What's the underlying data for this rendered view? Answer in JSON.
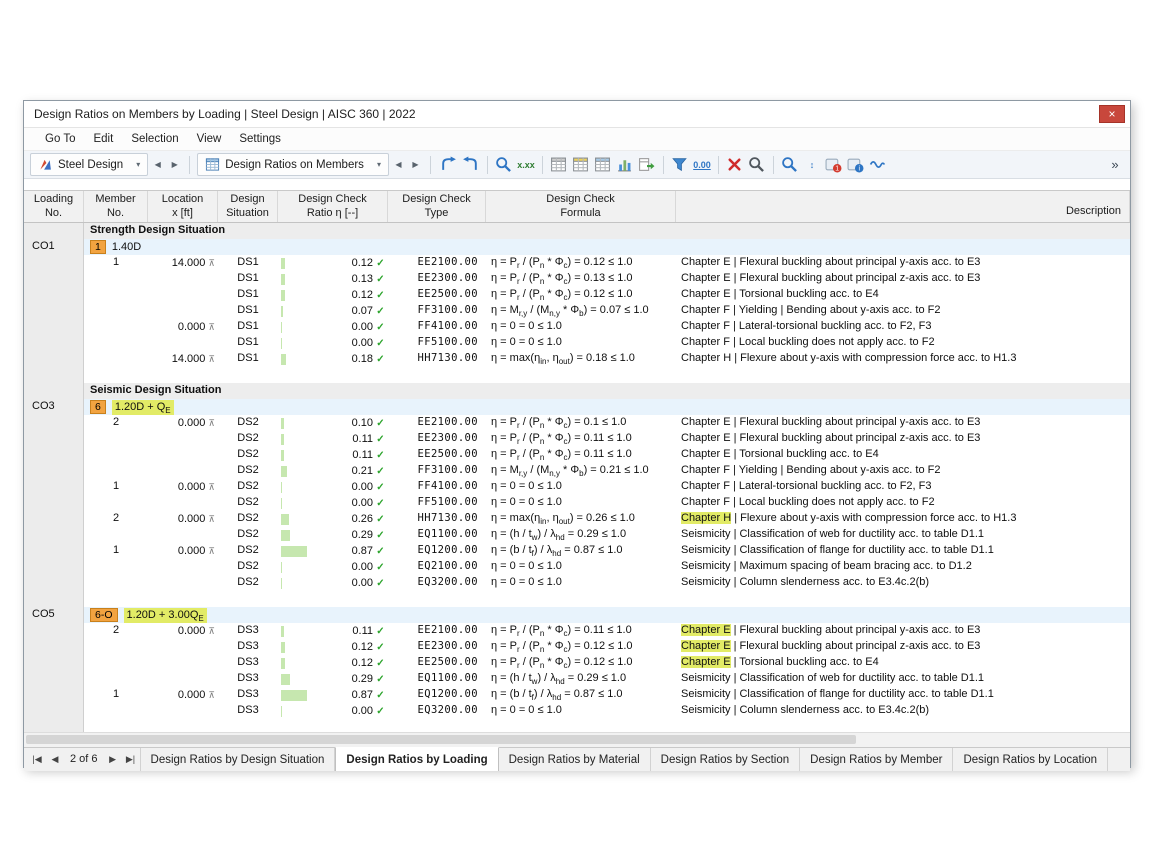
{
  "window": {
    "title": "Design Ratios on Members by Loading | Steel Design | AISC 360 | 2022"
  },
  "glyphs": {
    "close": "×",
    "chevron_down": "▾",
    "prev": "◀",
    "next": "▶",
    "first": "|◀",
    "last": "▶|",
    "check": "✓",
    "loc_extreme": "⊼",
    "overflow": "»"
  },
  "menu": {
    "items": [
      "Go To",
      "Edit",
      "Selection",
      "View",
      "Settings"
    ]
  },
  "toolbar": {
    "module_selector": "Steel Design",
    "table_selector": "Design Ratios on Members",
    "icon_groups": [
      [
        {
          "name": "show-in-graphic",
          "shape": "curve1"
        },
        {
          "name": "result-diagrams",
          "shape": "curve2"
        }
      ],
      [
        {
          "name": "search-result-values",
          "shape": "magnifier-blue"
        },
        {
          "name": "edit-result-values",
          "glyph": "x.xx",
          "color": "#2f7d32"
        }
      ],
      [
        {
          "name": "table-view",
          "shape": "grid"
        },
        {
          "name": "table-filter-view",
          "shape": "grid-yellow"
        },
        {
          "name": "table-settings",
          "shape": "grid-blue"
        },
        {
          "name": "result-chart",
          "shape": "chart"
        },
        {
          "name": "export-table",
          "shape": "export"
        }
      ],
      [
        {
          "name": "filter-results",
          "shape": "funnel"
        },
        {
          "name": "decimal-places",
          "glyph": "0.00",
          "color": "#2e75c4",
          "underline": true
        }
      ],
      [
        {
          "name": "delete-results",
          "shape": "redx"
        },
        {
          "name": "search",
          "shape": "magnifier"
        }
      ],
      [
        {
          "name": "find-in-table",
          "shape": "magnifier-blue"
        },
        {
          "name": "sort-results",
          "glyph": "↕",
          "color": "#2e75c4"
        },
        {
          "name": "messages",
          "shape": "badge-red"
        },
        {
          "name": "program-info",
          "shape": "badge-blue"
        },
        {
          "name": "comments",
          "shape": "wave"
        }
      ]
    ]
  },
  "table": {
    "columns": [
      {
        "lines": [
          "Loading",
          "No."
        ]
      },
      {
        "lines": [
          "Member",
          "No."
        ]
      },
      {
        "lines": [
          "Location",
          "x [ft]"
        ]
      },
      {
        "lines": [
          "Design",
          "Situation"
        ]
      },
      {
        "lines": [
          "Design Check",
          "Ratio η [--]"
        ]
      },
      {
        "lines": [
          "Design Check",
          "Type"
        ]
      },
      {
        "lines": [
          "Design Check",
          "Formula"
        ]
      },
      {
        "lines": [
          "Description"
        ],
        "align": "right"
      }
    ],
    "groups": [
      {
        "loading": "CO1",
        "section_title": "Strength Design Situation",
        "combo": {
          "badge": "1",
          "formula": "1.40D",
          "highlight": false
        },
        "rows": [
          {
            "m": "1",
            "x": "14.000",
            "ds": "DS1",
            "r": 0.12,
            "rt": "0.12",
            "t": "EE2100.00",
            "f": "η = P_r / (P_n * Φ_c) = 0.12 ≤ 1.0",
            "tag": "Chapter E",
            "hl": false,
            "d": "Flexural buckling about principal y-axis acc. to E3"
          },
          {
            "ds": "DS1",
            "r": 0.13,
            "rt": "0.13",
            "t": "EE2300.00",
            "f": "η = P_r / (P_n * Φ_c) = 0.13 ≤ 1.0",
            "tag": "Chapter E",
            "hl": false,
            "d": "Flexural buckling about principal z-axis acc. to E3"
          },
          {
            "ds": "DS1",
            "r": 0.12,
            "rt": "0.12",
            "t": "EE2500.00",
            "f": "η = P_r / (P_n * Φ_c) = 0.12 ≤ 1.0",
            "tag": "Chapter E",
            "hl": false,
            "d": "Torsional buckling acc. to E4"
          },
          {
            "ds": "DS1",
            "r": 0.07,
            "rt": "0.07",
            "t": "FF3100.00",
            "f": "η = M_r,y / (M_n,y * Φ_b) = 0.07 ≤ 1.0",
            "tag": "Chapter F",
            "hl": false,
            "d": "Yielding | Bending about y-axis acc. to F2"
          },
          {
            "x": "0.000",
            "ds": "DS1",
            "r": 0,
            "rt": "0.00",
            "t": "FF4100.00",
            "f": "η = 0 = 0 ≤ 1.0",
            "tag": "Chapter F",
            "hl": false,
            "d": "Lateral-torsional buckling acc. to F2, F3"
          },
          {
            "ds": "DS1",
            "r": 0,
            "rt": "0.00",
            "t": "FF5100.00",
            "f": "η = 0 = 0 ≤ 1.0",
            "tag": "Chapter F",
            "hl": false,
            "d": "Local buckling does not apply acc. to F2"
          },
          {
            "x": "14.000",
            "ds": "DS1",
            "r": 0.18,
            "rt": "0.18",
            "t": "HH7130.00",
            "f": "η = max(η_in, η_out) = 0.18 ≤ 1.0",
            "tag": "Chapter H",
            "hl": false,
            "d": "Flexure about y-axis with compression force acc. to H1.3"
          }
        ]
      },
      {
        "loading": "CO3",
        "section_title": "Seismic Design Situation",
        "combo": {
          "badge": "6",
          "formula": "1.20D + Q_E",
          "highlight": true
        },
        "rows": [
          {
            "m": "2",
            "x": "0.000",
            "ds": "DS2",
            "r": 0.1,
            "rt": "0.10",
            "t": "EE2100.00",
            "f": "η = P_r / (P_n * Φ_c) = 0.1 ≤ 1.0",
            "tag": "Chapter E",
            "hl": false,
            "d": "Flexural buckling about principal y-axis acc. to E3"
          },
          {
            "ds": "DS2",
            "r": 0.11,
            "rt": "0.11",
            "t": "EE2300.00",
            "f": "η = P_r / (P_n * Φ_c) = 0.11 ≤ 1.0",
            "tag": "Chapter E",
            "hl": false,
            "d": "Flexural buckling about principal z-axis acc. to E3"
          },
          {
            "ds": "DS2",
            "r": 0.11,
            "rt": "0.11",
            "t": "EE2500.00",
            "f": "η = P_r / (P_n * Φ_c) = 0.11 ≤ 1.0",
            "tag": "Chapter E",
            "hl": false,
            "d": "Torsional buckling acc. to E4"
          },
          {
            "ds": "DS2",
            "r": 0.21,
            "rt": "0.21",
            "t": "FF3100.00",
            "f": "η = M_r,y / (M_n,y * Φ_b) = 0.21 ≤ 1.0",
            "tag": "Chapter F",
            "hl": false,
            "d": "Yielding | Bending about y-axis acc. to F2"
          },
          {
            "m": "1",
            "x": "0.000",
            "ds": "DS2",
            "r": 0,
            "rt": "0.00",
            "t": "FF4100.00",
            "f": "η = 0 = 0 ≤ 1.0",
            "tag": "Chapter F",
            "hl": false,
            "d": "Lateral-torsional buckling acc. to F2, F3"
          },
          {
            "ds": "DS2",
            "r": 0,
            "rt": "0.00",
            "t": "FF5100.00",
            "f": "η = 0 = 0 ≤ 1.0",
            "tag": "Chapter F",
            "hl": false,
            "d": "Local buckling does not apply acc. to F2"
          },
          {
            "m": "2",
            "x": "0.000",
            "ds": "DS2",
            "r": 0.26,
            "rt": "0.26",
            "t": "HH7130.00",
            "f": "η = max(η_in, η_out) = 0.26 ≤ 1.0",
            "tag": "Chapter H",
            "hl": true,
            "d": "Flexure about y-axis with compression force acc. to H1.3"
          },
          {
            "ds": "DS2",
            "r": 0.29,
            "rt": "0.29",
            "t": "EQ1100.00",
            "f": "η = (h / t_w) / λ_hd = 0.29 ≤ 1.0",
            "tag": "Seismicity",
            "hl": false,
            "d": "Classification of web for ductility acc. to table D1.1"
          },
          {
            "m": "1",
            "x": "0.000",
            "ds": "DS2",
            "r": 0.87,
            "rt": "0.87",
            "t": "EQ1200.00",
            "f": "η = (b / t_f) / λ_hd = 0.87 ≤ 1.0",
            "tag": "Seismicity",
            "hl": false,
            "d": "Classification of flange for ductility acc. to table D1.1"
          },
          {
            "ds": "DS2",
            "r": 0,
            "rt": "0.00",
            "t": "EQ2100.00",
            "f": "η = 0 = 0 ≤ 1.0",
            "tag": "Seismicity",
            "hl": false,
            "d": "Maximum spacing of beam bracing acc. to D1.2"
          },
          {
            "ds": "DS2",
            "r": 0,
            "rt": "0.00",
            "t": "EQ3200.00",
            "f": "η = 0 = 0 ≤ 1.0",
            "tag": "Seismicity",
            "hl": false,
            "d": "Column slenderness acc. to E3.4c.2(b)"
          }
        ]
      },
      {
        "loading": "CO5",
        "section_title": null,
        "combo": {
          "badge": "6-O",
          "formula": "1.20D + 3.00Q_E",
          "highlight": true
        },
        "rows": [
          {
            "m": "2",
            "x": "0.000",
            "ds": "DS3",
            "r": 0.11,
            "rt": "0.11",
            "t": "EE2100.00",
            "f": "η = P_r / (P_n * Φ_c) = 0.11 ≤ 1.0",
            "tag": "Chapter E",
            "hl": true,
            "d": "Flexural buckling about principal y-axis acc. to E3"
          },
          {
            "ds": "DS3",
            "r": 0.12,
            "rt": "0.12",
            "t": "EE2300.00",
            "f": "η = P_r / (P_n * Φ_c) = 0.12 ≤ 1.0",
            "tag": "Chapter E",
            "hl": true,
            "d": "Flexural buckling about principal z-axis acc. to E3"
          },
          {
            "ds": "DS3",
            "r": 0.12,
            "rt": "0.12",
            "t": "EE2500.00",
            "f": "η = P_r / (P_n * Φ_c) = 0.12 ≤ 1.0",
            "tag": "Chapter E",
            "hl": true,
            "d": "Torsional buckling acc. to E4"
          },
          {
            "ds": "DS3",
            "r": 0.29,
            "rt": "0.29",
            "t": "EQ1100.00",
            "f": "η = (h / t_w) / λ_hd = 0.29 ≤ 1.0",
            "tag": "Seismicity",
            "hl": false,
            "d": "Classification of web for ductility acc. to table D1.1"
          },
          {
            "m": "1",
            "x": "0.000",
            "ds": "DS3",
            "r": 0.87,
            "rt": "0.87",
            "t": "EQ1200.00",
            "f": "η = (b / t_f) / λ_hd = 0.87 ≤ 1.0",
            "tag": "Seismicity",
            "hl": false,
            "d": "Classification of flange for ductility acc. to table D1.1"
          },
          {
            "ds": "DS3",
            "r": 0,
            "rt": "0.00",
            "t": "EQ3200.00",
            "f": "η = 0 = 0 ≤ 1.0",
            "tag": "Seismicity",
            "hl": false,
            "d": "Column slenderness acc. to E3.4c.2(b)"
          }
        ]
      }
    ]
  },
  "pager": {
    "label": "2 of 6"
  },
  "tabs": [
    {
      "label": "Design Ratios by Design Situation",
      "active": false
    },
    {
      "label": "Design Ratios by Loading",
      "active": true
    },
    {
      "label": "Design Ratios by Material",
      "active": false
    },
    {
      "label": "Design Ratios by Section",
      "active": false
    },
    {
      "label": "Design Ratios by Member",
      "active": false
    },
    {
      "label": "Design Ratios by Location",
      "active": false
    }
  ]
}
